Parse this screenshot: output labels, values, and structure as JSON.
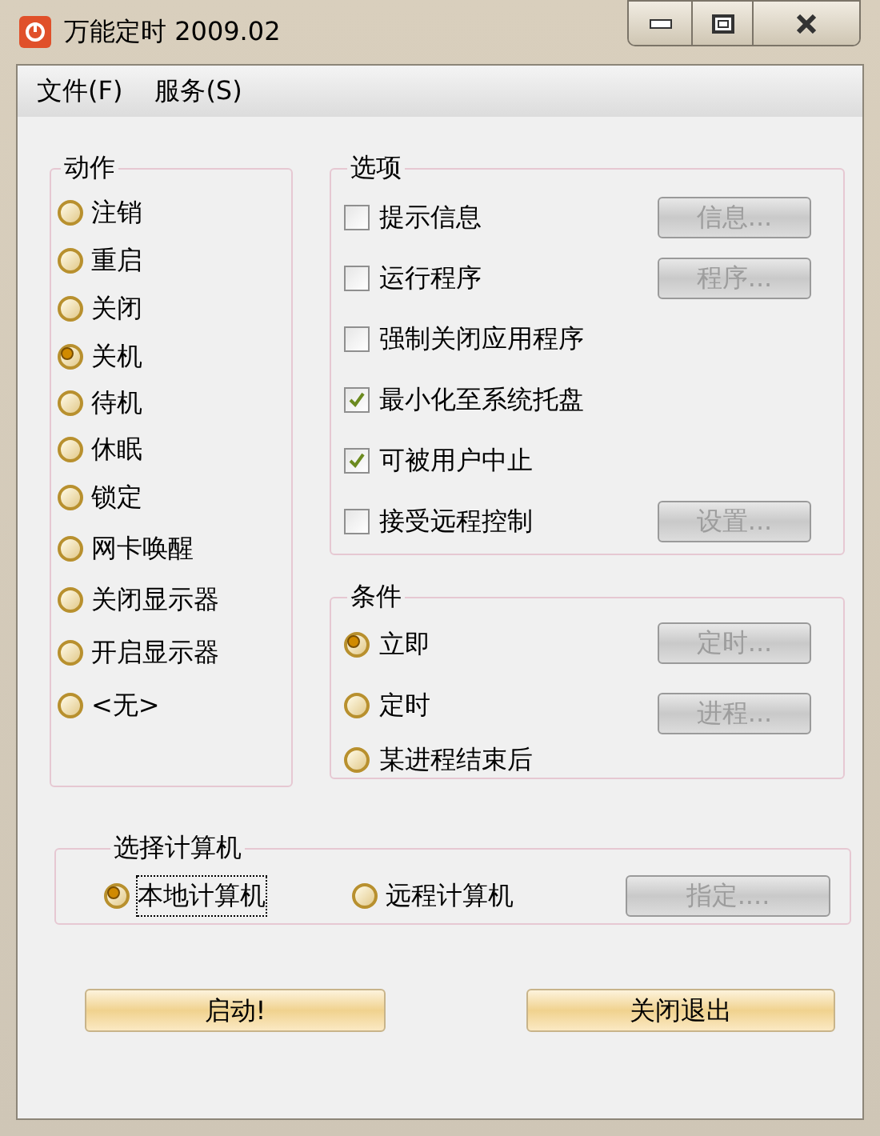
{
  "window": {
    "title": "万能定时 2009.02"
  },
  "menu": [
    {
      "label": "文件(F)"
    },
    {
      "label": "服务(S)"
    }
  ],
  "actions": {
    "title": "动作",
    "options": [
      {
        "label": "注销",
        "selected": false
      },
      {
        "label": "重启",
        "selected": false
      },
      {
        "label": "关闭",
        "selected": false
      },
      {
        "label": "关机",
        "selected": true
      },
      {
        "label": "待机",
        "selected": false
      },
      {
        "label": "休眠",
        "selected": false
      },
      {
        "label": "锁定",
        "selected": false
      },
      {
        "label": "网卡唤醒",
        "selected": false
      },
      {
        "label": "关闭显示器",
        "selected": false
      },
      {
        "label": "开启显示器",
        "selected": false
      },
      {
        "label": "<无>",
        "selected": false
      }
    ]
  },
  "options": {
    "title": "选项",
    "items": [
      {
        "label": "提示信息",
        "checked": false,
        "button": {
          "label": "信息...",
          "disabled": true
        }
      },
      {
        "label": "运行程序",
        "checked": false,
        "button": {
          "label": "程序...",
          "disabled": true
        }
      },
      {
        "label": "强制关闭应用程序",
        "checked": false
      },
      {
        "label": "最小化至系统托盘",
        "checked": true
      },
      {
        "label": "可被用户中止",
        "checked": true
      },
      {
        "label": "接受远程控制",
        "checked": false,
        "button": {
          "label": "设置...",
          "disabled": true
        }
      }
    ]
  },
  "conditions": {
    "title": "条件",
    "options": [
      {
        "label": "立即",
        "selected": true,
        "button": {
          "label": "定时...",
          "disabled": true
        }
      },
      {
        "label": "定时",
        "selected": false,
        "button": {
          "label": "进程...",
          "disabled": true
        }
      },
      {
        "label": "某进程结束后",
        "selected": false
      }
    ]
  },
  "computer": {
    "title": "选择计算机",
    "options": [
      {
        "label": "本地计算机",
        "selected": true,
        "focused": true
      },
      {
        "label": "远程计算机",
        "selected": false,
        "focused": false
      }
    ],
    "button": {
      "label": "指定....",
      "disabled": true
    }
  },
  "buttons": [
    {
      "label": "启动!"
    },
    {
      "label": "关闭退出"
    }
  ]
}
